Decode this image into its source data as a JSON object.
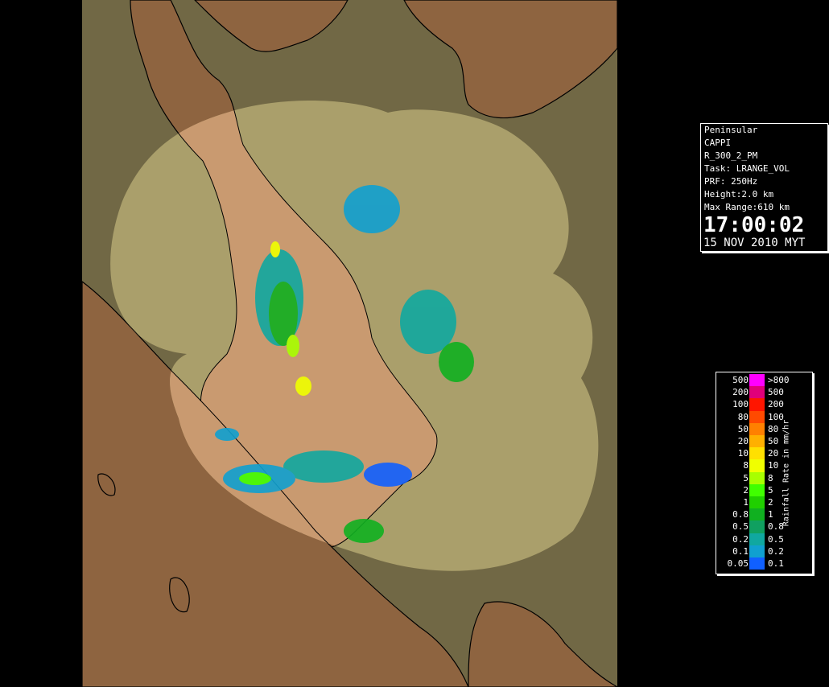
{
  "info": {
    "lines": [
      "Peninsular",
      "CAPPI",
      "R_300_2_PM",
      "Task: LRANGE_VOL",
      "PRF: 250Hz",
      "Height:2.0 km",
      "Max Range:610 km"
    ],
    "time": "17:00:02",
    "date": "15 NOV 2010 MYT"
  },
  "legend": {
    "title": "Rainfall Rate in mm/hr",
    "rows": [
      {
        "lo": "500",
        "hi": ">800",
        "color": "#ff00ff"
      },
      {
        "lo": "200",
        "hi": "500",
        "color": "#e0007a"
      },
      {
        "lo": "100",
        "hi": "200",
        "color": "#ff1500"
      },
      {
        "lo": "80",
        "hi": "100",
        "color": "#ff4a00"
      },
      {
        "lo": "50",
        "hi": "80",
        "color": "#ff8000"
      },
      {
        "lo": "20",
        "hi": "50",
        "color": "#ffb000"
      },
      {
        "lo": "10",
        "hi": "20",
        "color": "#ffe000"
      },
      {
        "lo": "8",
        "hi": "10",
        "color": "#f0ff00"
      },
      {
        "lo": "5",
        "hi": "8",
        "color": "#a8ff00"
      },
      {
        "lo": "2",
        "hi": "5",
        "color": "#40ff00"
      },
      {
        "lo": "1",
        "hi": "2",
        "color": "#20d000"
      },
      {
        "lo": "0.8",
        "hi": "1",
        "color": "#10b020"
      },
      {
        "lo": "0.5",
        "hi": "0.8",
        "color": "#10a060"
      },
      {
        "lo": "0.2",
        "hi": "0.5",
        "color": "#10a8a0"
      },
      {
        "lo": "0.1",
        "hi": "0.2",
        "color": "#10a0d0"
      },
      {
        "lo": "0.05",
        "hi": "0.1",
        "color": "#1060ff"
      }
    ]
  },
  "colors": {
    "sea": "#716845",
    "land": "#8e6440",
    "coverage_sea": "#aa9f6b",
    "coverage_land": "#c99a70"
  }
}
